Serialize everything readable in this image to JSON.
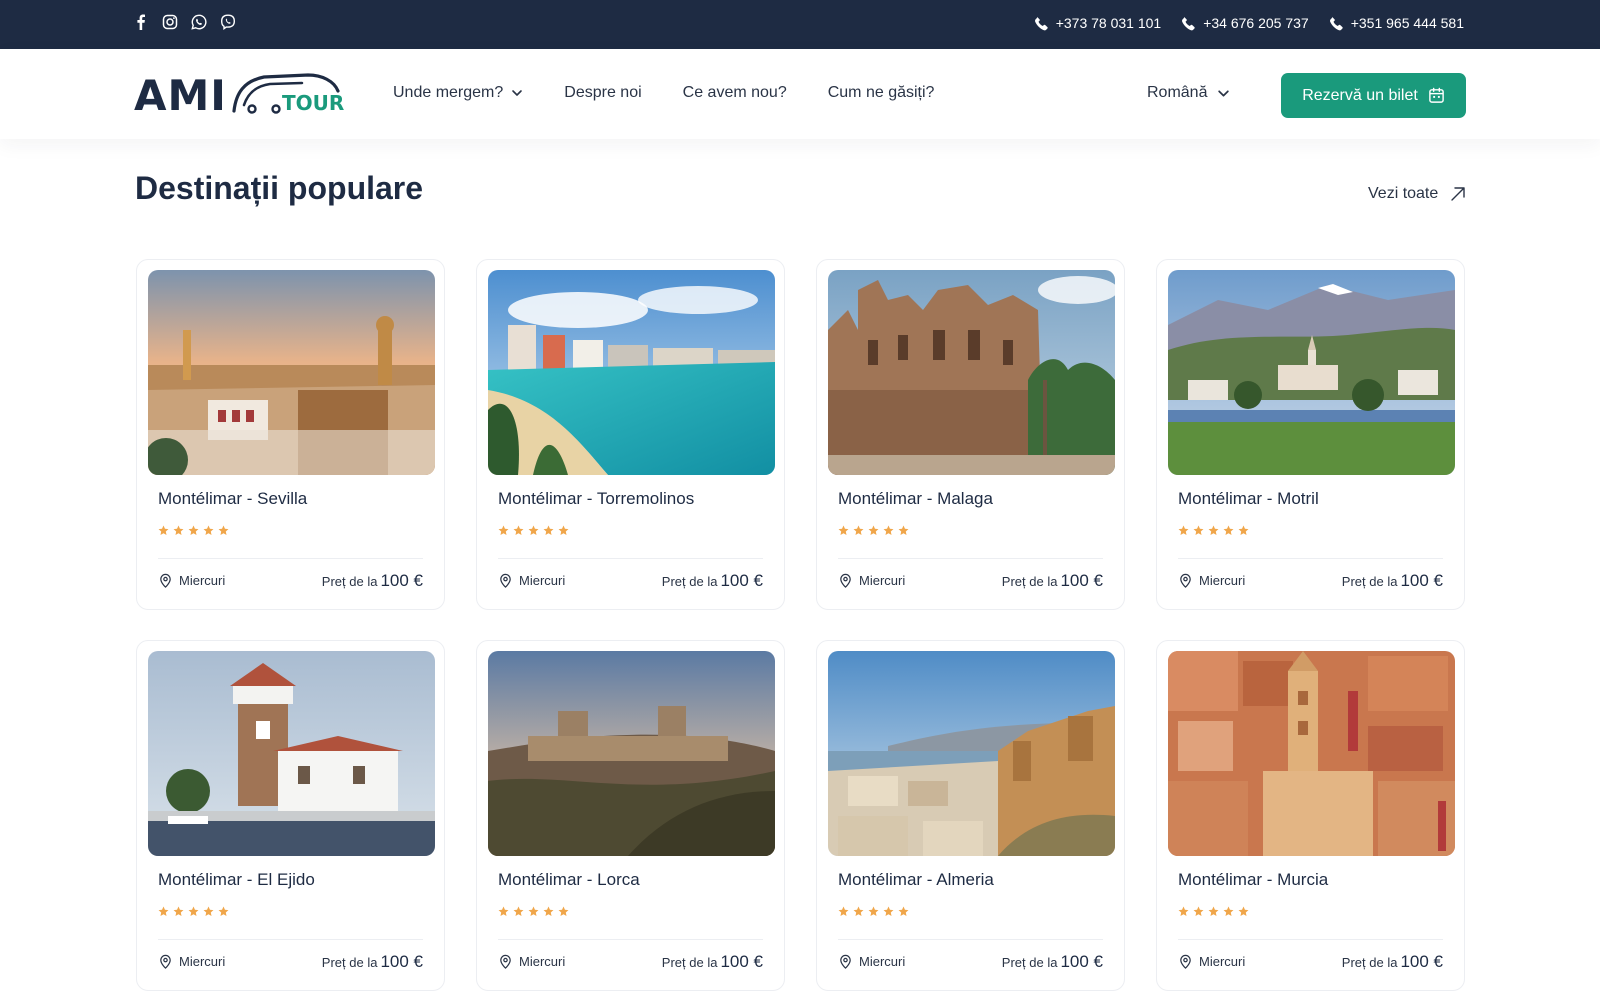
{
  "topbar": {
    "social": [
      {
        "icon": "facebook-icon"
      },
      {
        "icon": "instagram-icon"
      },
      {
        "icon": "whatsapp-icon"
      },
      {
        "icon": "viber-icon"
      }
    ],
    "phones": [
      "+373 78 031 101",
      "+34 676 205 737",
      "+351 965 444 581"
    ]
  },
  "header": {
    "logo_main": "AMI",
    "logo_sub": "TOUR",
    "nav": [
      {
        "label": "Unde mergem?",
        "has_dropdown": true
      },
      {
        "label": "Despre noi",
        "has_dropdown": false
      },
      {
        "label": "Ce avem nou?",
        "has_dropdown": false
      },
      {
        "label": "Cum ne găsiți?",
        "has_dropdown": false
      }
    ],
    "language": "Română",
    "book_button": "Rezervă un bilet"
  },
  "section": {
    "title": "Destinații populare",
    "see_all": "Vezi toate"
  },
  "price_prefix": "Preț de la",
  "colors": {
    "topbar": "#1e2b43",
    "accent": "#1a9a7c",
    "star": "#f0a64a",
    "text": "#1e2b43"
  },
  "destinations": [
    {
      "title": "Montélimar - Sevilla",
      "rating": 5,
      "day": "Miercuri",
      "price": "100 €",
      "image": "sevilla-sunset-city"
    },
    {
      "title": "Montélimar - Torremolinos",
      "rating": 5,
      "day": "Miercuri",
      "price": "100 €",
      "image": "torremolinos-beach"
    },
    {
      "title": "Montélimar - Malaga",
      "rating": 5,
      "day": "Miercuri",
      "price": "100 €",
      "image": "malaga-cathedral"
    },
    {
      "title": "Montélimar - Motril",
      "rating": 5,
      "day": "Miercuri",
      "price": "100 €",
      "image": "motril-mountains-town"
    },
    {
      "title": "Montélimar - El Ejido",
      "rating": 5,
      "day": "Miercuri",
      "price": "100 €",
      "image": "el-ejido-tower-house"
    },
    {
      "title": "Montélimar - Lorca",
      "rating": 5,
      "day": "Miercuri",
      "price": "100 €",
      "image": "lorca-castle"
    },
    {
      "title": "Montélimar - Almeria",
      "rating": 5,
      "day": "Miercuri",
      "price": "100 €",
      "image": "almeria-fortress"
    },
    {
      "title": "Montélimar - Murcia",
      "rating": 5,
      "day": "Miercuri",
      "price": "100 €",
      "image": "murcia-rooftops"
    }
  ]
}
